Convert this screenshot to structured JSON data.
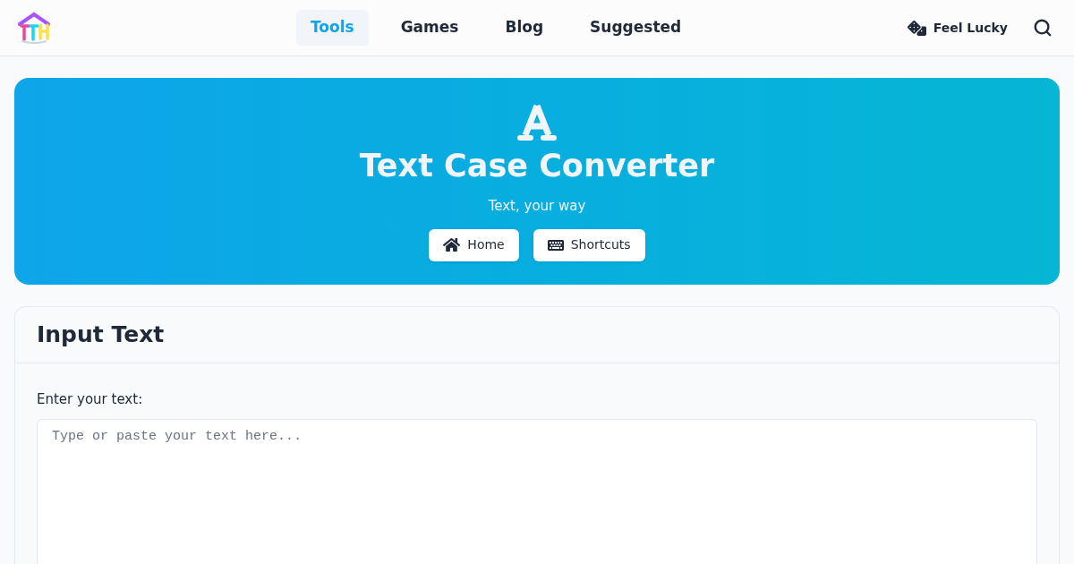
{
  "nav": {
    "items": [
      {
        "label": "Tools",
        "selected": true
      },
      {
        "label": "Games",
        "selected": false
      },
      {
        "label": "Blog",
        "selected": false
      },
      {
        "label": "Suggested",
        "selected": false
      }
    ],
    "lucky": "Feel Lucky"
  },
  "hero": {
    "title": "Text Case Converter",
    "subtitle": "Text, your way",
    "buttons": [
      {
        "kind": "home",
        "label": "Home"
      },
      {
        "kind": "shortcuts",
        "label": "Shortcuts"
      }
    ]
  },
  "card": {
    "title": "Input Text",
    "label": "Enter your text:",
    "placeholder": "Type or paste your text here..."
  }
}
